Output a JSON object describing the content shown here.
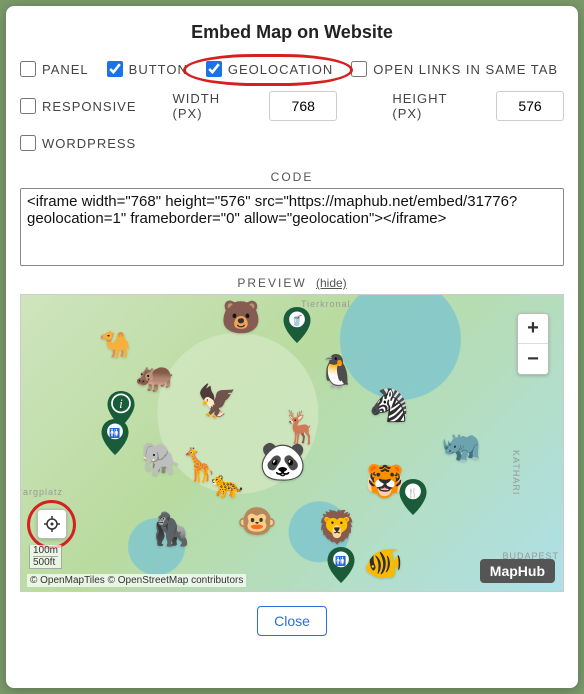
{
  "title": "Embed Map on Website",
  "options": {
    "panel": {
      "label": "PANEL",
      "checked": false
    },
    "button": {
      "label": "BUTTON",
      "checked": true
    },
    "geo": {
      "label": "GEOLOCATION",
      "checked": true
    },
    "sametab": {
      "label": "OPEN LINKS IN SAME TAB",
      "checked": false
    },
    "responsive": {
      "label": "RESPONSIVE",
      "checked": false
    },
    "wordpress": {
      "label": "WORDPRESS",
      "checked": false
    }
  },
  "dims": {
    "width_label": "WIDTH (PX)",
    "width_value": "768",
    "height_label": "HEIGHT (PX)",
    "height_value": "576"
  },
  "code_label": "CODE",
  "code_value": "<iframe width=\"768\" height=\"576\" src=\"https://maphub.net/embed/31776?geolocation=1\" frameborder=\"0\" allow=\"geolocation\"></iframe>",
  "preview_label": "PREVIEW",
  "preview_hide": "(hide)",
  "zoom": {
    "in": "+",
    "out": "−"
  },
  "scale": {
    "metric": "100m",
    "imperial": "500ft"
  },
  "attribution": "© OpenMapTiles © OpenStreetMap contributors",
  "brand": "MapHub",
  "roads": {
    "r1": "Tierkronal",
    "r2": "BUDAPEST",
    "r3": "KATHARI",
    "r4": "argplatz"
  },
  "close": "Close"
}
